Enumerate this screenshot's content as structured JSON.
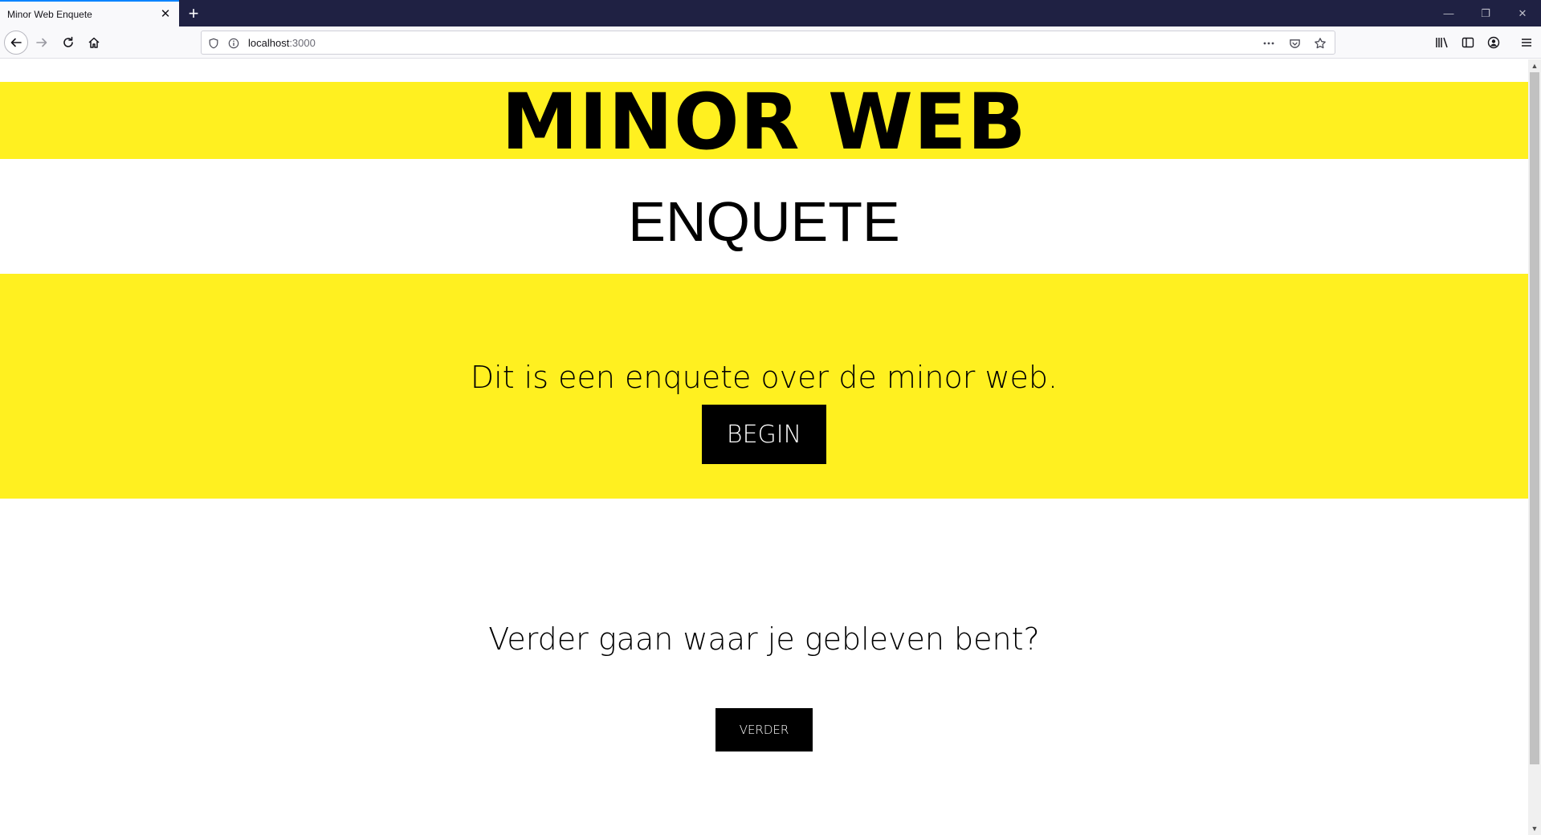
{
  "browser": {
    "tab_title": "Minor Web Enquete",
    "tab_close_glyph": "✕",
    "new_tab_glyph": "+",
    "url_host": "localhost",
    "url_port": ":3000",
    "window_controls": {
      "minimize": "—",
      "restore": "❐",
      "close": "✕"
    },
    "icons": [
      "back-icon",
      "forward-icon",
      "reload-icon",
      "home-icon",
      "shield-icon",
      "info-icon",
      "more-icon",
      "pocket-icon",
      "bookmark-star-icon",
      "library-icon",
      "sidebar-icon",
      "account-icon",
      "menu-icon"
    ]
  },
  "page": {
    "title": "MINOR WEB",
    "subtitle": "ENQUETE",
    "intro_text": "Dit is een enquete over de minor web.",
    "begin_label": "BEGIN",
    "resume_text": "Verder gaan waar je gebleven bent?",
    "verder_label": "VERDER"
  },
  "colors": {
    "accent_yellow": "#fff020",
    "button_black": "#000000",
    "tabbar_dark": "#1f2143",
    "tab_highlight": "#0a84ff"
  }
}
